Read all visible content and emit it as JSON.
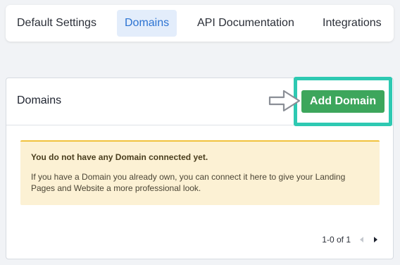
{
  "tabs": [
    {
      "label": "Default Settings",
      "active": false
    },
    {
      "label": "Domains",
      "active": true
    },
    {
      "label": "API Documentation",
      "active": false
    },
    {
      "label": "Integrations",
      "active": false
    }
  ],
  "card": {
    "title": "Domains",
    "add_button_label": "Add Domain",
    "alert": {
      "title": "You do not have any Domain connected yet.",
      "body": "If you have a Domain you already own, you can connect it here to give your Landing Pages and Website a more professional look."
    },
    "pagination": {
      "range_text": "1-0 of 1"
    }
  },
  "colors": {
    "accent": "#2c73d2",
    "active_tab_bg": "#e3edfb",
    "button_green": "#3da65c",
    "highlight_teal": "#2ec9b2",
    "alert_bg": "#fcf1d4",
    "alert_border": "#f1c23e"
  },
  "icons": [
    "pointer-arrow-icon",
    "chevron-left-icon",
    "chevron-right-icon"
  ]
}
